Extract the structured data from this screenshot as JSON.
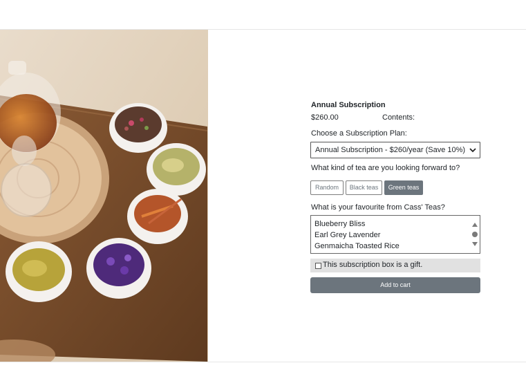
{
  "product": {
    "title": "Annual Subscription",
    "price": "$260.00",
    "contents_label": "Contents:"
  },
  "plan": {
    "label": "Choose a Subscription Plan:",
    "selected": "Annual Subscription - $260/year (Save 10%)"
  },
  "tea_type": {
    "question": "What kind of tea are you looking forward to?",
    "options": [
      "Random",
      "Black teas",
      "Green teas"
    ],
    "selected": "Green teas"
  },
  "favourite": {
    "question": "What is your favourite from Cass' Teas?",
    "options": [
      "Blueberry Bliss",
      "Earl Grey Lavender",
      "Genmaicha Toasted Rice"
    ]
  },
  "gift": {
    "label": "This subscription box is a gift.",
    "checked": false
  },
  "cart": {
    "label": "Add to cart"
  },
  "colors": {
    "button_gray": "#6c757d",
    "gift_bg": "#e1e1e1"
  }
}
